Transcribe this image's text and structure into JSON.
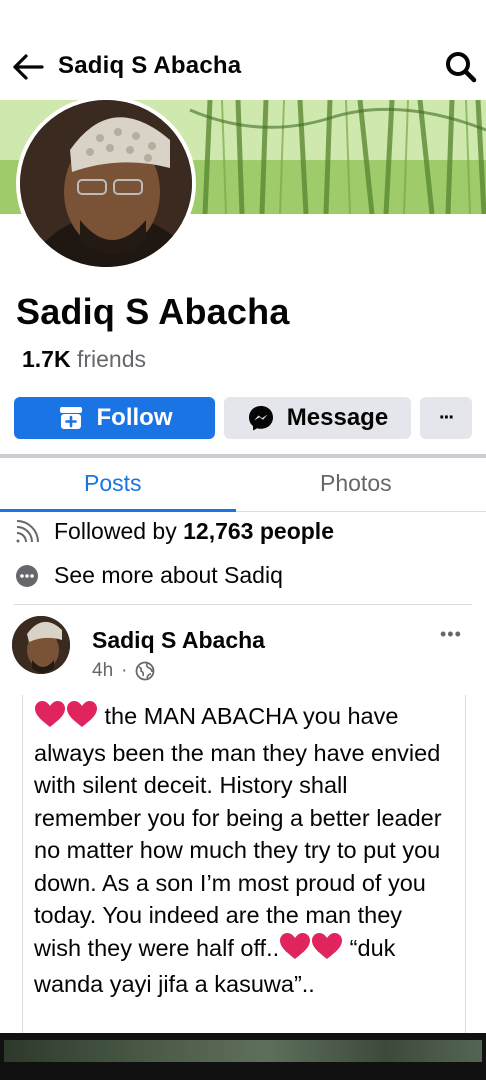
{
  "topbar": {
    "title": "Sadiq S Abacha"
  },
  "profile": {
    "name": "Sadiq S Abacha",
    "friends_count": "1.7K",
    "friends_label": "friends"
  },
  "actions": {
    "follow_label": "Follow",
    "message_label": "Message",
    "more_label": "···"
  },
  "tabs": [
    {
      "label": "Posts",
      "active": true
    },
    {
      "label": "Photos",
      "active": false
    }
  ],
  "about": {
    "followed_prefix": "Followed by",
    "followed_count": "12,763 people",
    "see_more": "See more about Sadiq"
  },
  "post": {
    "author": "Sadiq S Abacha",
    "time": "4h",
    "separator": "·",
    "audience_icon": "globe-icon",
    "more_label": "•••",
    "text_part1": " the MAN ABACHA you have always been the man they have envied with silent deceit. History shall remember you for being a better leader no matter how much they try to put you down. As a son I’m most proud of you today. You indeed are the man they wish they were half off..",
    "text_part2": "  “duk wanda yayi jifa a kasuwa”.."
  },
  "colors": {
    "accent": "#1b74e4",
    "secondary_button": "#e4e6eb",
    "muted_text": "#65676b",
    "heart": "#e0245e"
  }
}
